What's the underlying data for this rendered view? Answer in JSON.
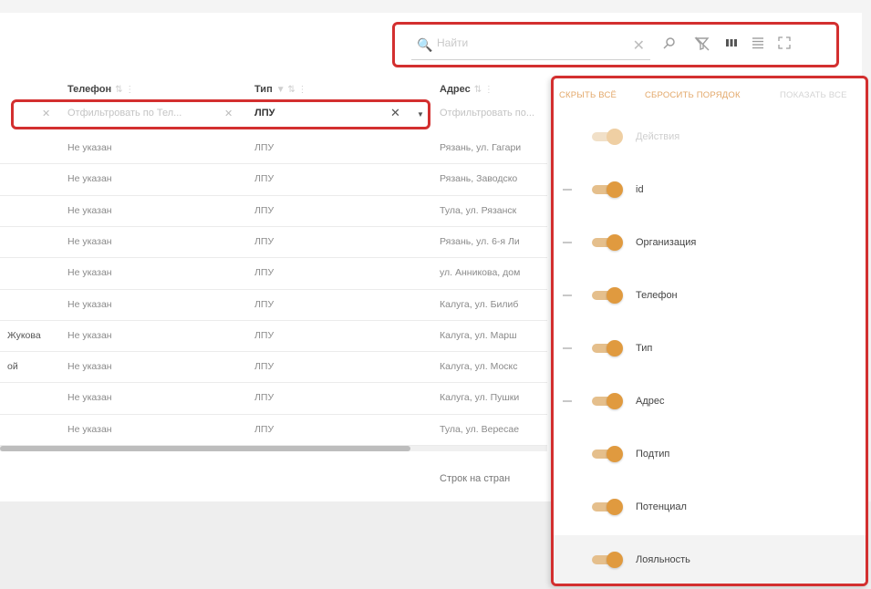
{
  "toolbar": {
    "search_placeholder": "Найти",
    "search_clear": "✕",
    "icons": [
      "search-off-icon",
      "filter-off-icon",
      "columns-icon",
      "density-icon",
      "fullscreen-icon"
    ]
  },
  "table": {
    "columns": [
      {
        "label": "Телефон",
        "controls": "⇅ ⋮"
      },
      {
        "label": "Тип",
        "controls": "▼ ⇅ ⋮"
      },
      {
        "label": "Адрес",
        "controls": "⇅ ⋮"
      }
    ],
    "filters": {
      "phone_placeholder": "Отфильтровать по Тел...",
      "type_value": "ЛПУ",
      "address_placeholder": "Отфильтровать по..."
    },
    "rows": [
      {
        "org": "",
        "phone": "Не указан",
        "type": "ЛПУ",
        "address": "Рязань, ул. Гагари"
      },
      {
        "org": "",
        "phone": "Не указан",
        "type": "ЛПУ",
        "address": "Рязань, Заводско"
      },
      {
        "org": "",
        "phone": "Не указан",
        "type": "ЛПУ",
        "address": "Тула, ул. Рязанск"
      },
      {
        "org": "",
        "phone": "Не указан",
        "type": "ЛПУ",
        "address": "Рязань, ул. 6-я Ли"
      },
      {
        "org": "",
        "phone": "Не указан",
        "type": "ЛПУ",
        "address": "ул. Анникова, дом"
      },
      {
        "org": "",
        "phone": "Не указан",
        "type": "ЛПУ",
        "address": "Калуга, ул. Билиб"
      },
      {
        "org": "Жукова",
        "phone": "Не указан",
        "type": "ЛПУ",
        "address": "Калуга, ул. Марш"
      },
      {
        "org": "ой",
        "phone": "Не указан",
        "type": "ЛПУ",
        "address": "Калуга, ул. Москс"
      },
      {
        "org": "",
        "phone": "Не указан",
        "type": "ЛПУ",
        "address": "Калуга, ул. Пушки"
      },
      {
        "org": "",
        "phone": "Не указан",
        "type": "ЛПУ",
        "address": "Тула, ул. Вересае"
      }
    ],
    "scroll_fraction": 0.75,
    "rows_per_page_label": "Строк на стран"
  },
  "columns_panel": {
    "hide_all": "СКРЫТЬ ВСЁ",
    "reset_order": "СБРОСИТЬ ПОРЯДОК",
    "show_all": "ПОКАЗАТЬ ВСЕ",
    "items": [
      {
        "label": "Действия",
        "disabled": true,
        "draggable": false
      },
      {
        "label": "id",
        "disabled": false,
        "draggable": true
      },
      {
        "label": "Организация",
        "disabled": false,
        "draggable": true
      },
      {
        "label": "Телефон",
        "disabled": false,
        "draggable": true
      },
      {
        "label": "Тип",
        "disabled": false,
        "draggable": true
      },
      {
        "label": "Адрес",
        "disabled": false,
        "draggable": true
      },
      {
        "label": "Подтип",
        "disabled": false,
        "draggable": false
      },
      {
        "label": "Потенциал",
        "disabled": false,
        "draggable": false
      },
      {
        "label": "Лояльность",
        "disabled": false,
        "draggable": false
      }
    ]
  },
  "colors": {
    "highlight": "#d32f2f",
    "toggle_on": "#e09a3f",
    "accent_text": "#e3a86a"
  }
}
